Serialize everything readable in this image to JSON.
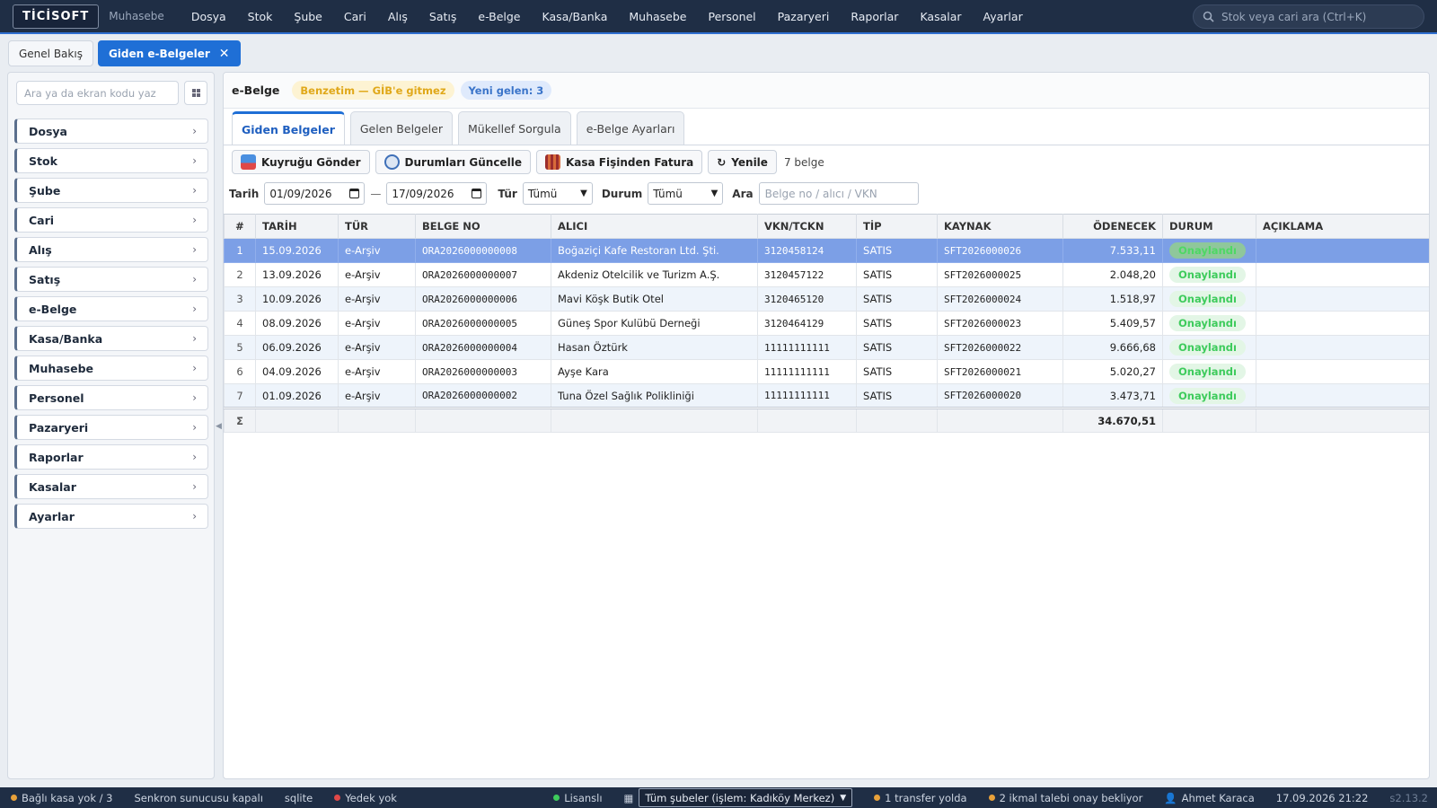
{
  "topbar": {
    "logo": "TİCİSOFT",
    "app_name": "Muhasebe",
    "nav": [
      "Dosya",
      "Stok",
      "Şube",
      "Cari",
      "Alış",
      "Satış",
      "e-Belge",
      "Kasa/Banka",
      "Muhasebe",
      "Personel",
      "Pazaryeri",
      "Raporlar",
      "Kasalar",
      "Ayarlar"
    ],
    "search_placeholder": "Stok veya cari ara (Ctrl+K)"
  },
  "page_tabs": [
    {
      "label": "Genel Bakış",
      "active": false
    },
    {
      "label": "Giden e-Belgeler",
      "active": true,
      "close": "✕"
    }
  ],
  "sidebar": {
    "search_placeholder": "Ara ya da ekran kodu yaz",
    "grid_icon": "grid-icon",
    "items": [
      "Dosya",
      "Stok",
      "Şube",
      "Cari",
      "Alış",
      "Satış",
      "e-Belge",
      "Kasa/Banka",
      "Muhasebe",
      "Personel",
      "Pazaryeri",
      "Raporlar",
      "Kasalar",
      "Ayarlar"
    ]
  },
  "main": {
    "title": "e-Belge",
    "badge_warn": "Benzetim — GİB'e gitmez",
    "badge_info": "Yeni gelen: 3",
    "tabs": [
      "Giden Belgeler",
      "Gelen Belgeler",
      "Mükellef Sorgula",
      "e-Belge Ayarları"
    ],
    "toolbar": {
      "send_queue": "Kuyruğu Gönder",
      "update_status": "Durumları Güncelle",
      "invoice_from_receipt": "Kasa Fişinden Fatura",
      "refresh": "Yenile",
      "count": "7 belge"
    },
    "filters": {
      "date_label": "Tarih",
      "date_from": "01/09/2026",
      "date_sep": "—",
      "date_to": "17/09/2026",
      "type_label": "Tür",
      "type_value": "Tümü",
      "status_label": "Durum",
      "status_value": "Tümü",
      "search_label": "Ara",
      "search_placeholder": "Belge no / alıcı / VKN"
    },
    "table": {
      "headers": [
        "#",
        "TARİH",
        "TÜR",
        "BELGE NO",
        "ALICI",
        "VKN/TCKN",
        "TİP",
        "KAYNAK",
        "ÖDENECEK",
        "DURUM",
        "AÇIKLAMA"
      ],
      "rows": [
        {
          "n": "1",
          "date": "15.09.2026",
          "type": "e-Arşiv",
          "no": "ORA2026000000008",
          "buyer": "Boğaziçi Kafe Restoran Ltd. Şti.",
          "vkn": "3120458124",
          "tip": "SATIS",
          "source": "SFT2026000026",
          "amount": "7.533,11",
          "status": "Onaylandı",
          "note": ""
        },
        {
          "n": "2",
          "date": "13.09.2026",
          "type": "e-Arşiv",
          "no": "ORA2026000000007",
          "buyer": "Akdeniz Otelcilik ve Turizm A.Ş.",
          "vkn": "3120457122",
          "tip": "SATIS",
          "source": "SFT2026000025",
          "amount": "2.048,20",
          "status": "Onaylandı",
          "note": ""
        },
        {
          "n": "3",
          "date": "10.09.2026",
          "type": "e-Arşiv",
          "no": "ORA2026000000006",
          "buyer": "Mavi Köşk Butik Otel",
          "vkn": "3120465120",
          "tip": "SATIS",
          "source": "SFT2026000024",
          "amount": "1.518,97",
          "status": "Onaylandı",
          "note": ""
        },
        {
          "n": "4",
          "date": "08.09.2026",
          "type": "e-Arşiv",
          "no": "ORA2026000000005",
          "buyer": "Güneş Spor Kulübü Derneği",
          "vkn": "3120464129",
          "tip": "SATIS",
          "source": "SFT2026000023",
          "amount": "5.409,57",
          "status": "Onaylandı",
          "note": ""
        },
        {
          "n": "5",
          "date": "06.09.2026",
          "type": "e-Arşiv",
          "no": "ORA2026000000004",
          "buyer": "Hasan Öztürk",
          "vkn": "11111111111",
          "tip": "SATIS",
          "source": "SFT2026000022",
          "amount": "9.666,68",
          "status": "Onaylandı",
          "note": ""
        },
        {
          "n": "6",
          "date": "04.09.2026",
          "type": "e-Arşiv",
          "no": "ORA2026000000003",
          "buyer": "Ayşe Kara",
          "vkn": "11111111111",
          "tip": "SATIS",
          "source": "SFT2026000021",
          "amount": "5.020,27",
          "status": "Onaylandı",
          "note": ""
        },
        {
          "n": "7",
          "date": "01.09.2026",
          "type": "e-Arşiv",
          "no": "ORA2026000000002",
          "buyer": "Tuna Özel Sağlık Polikliniği",
          "vkn": "11111111111",
          "tip": "SATIS",
          "source": "SFT2026000020",
          "amount": "3.473,71",
          "status": "Onaylandı",
          "note": ""
        }
      ],
      "total_symbol": "Σ",
      "total_amount": "34.670,51"
    }
  },
  "statusbar": {
    "kasa": "Bağlı kasa yok / 3",
    "sync": "Senkron sunucusu kapalı",
    "db": "sqlite",
    "backup": "Yedek yok",
    "license": "Lisanslı",
    "branch": "Tüm şubeler (işlem: Kadıköy Merkez)",
    "transfer": "1 transfer yolda",
    "requests": "2 ikmal talebi onay bekliyor",
    "user": "Ahmet Karaca",
    "datetime": "17.09.2026 21:22",
    "version": "s2.13.2"
  },
  "colors": {
    "topbar": "#1f2e45",
    "accent": "#1f6fd6",
    "selected_row": "#7c9fe6",
    "status_ok": "#3ecb5c",
    "warn": "#e0a81a"
  }
}
